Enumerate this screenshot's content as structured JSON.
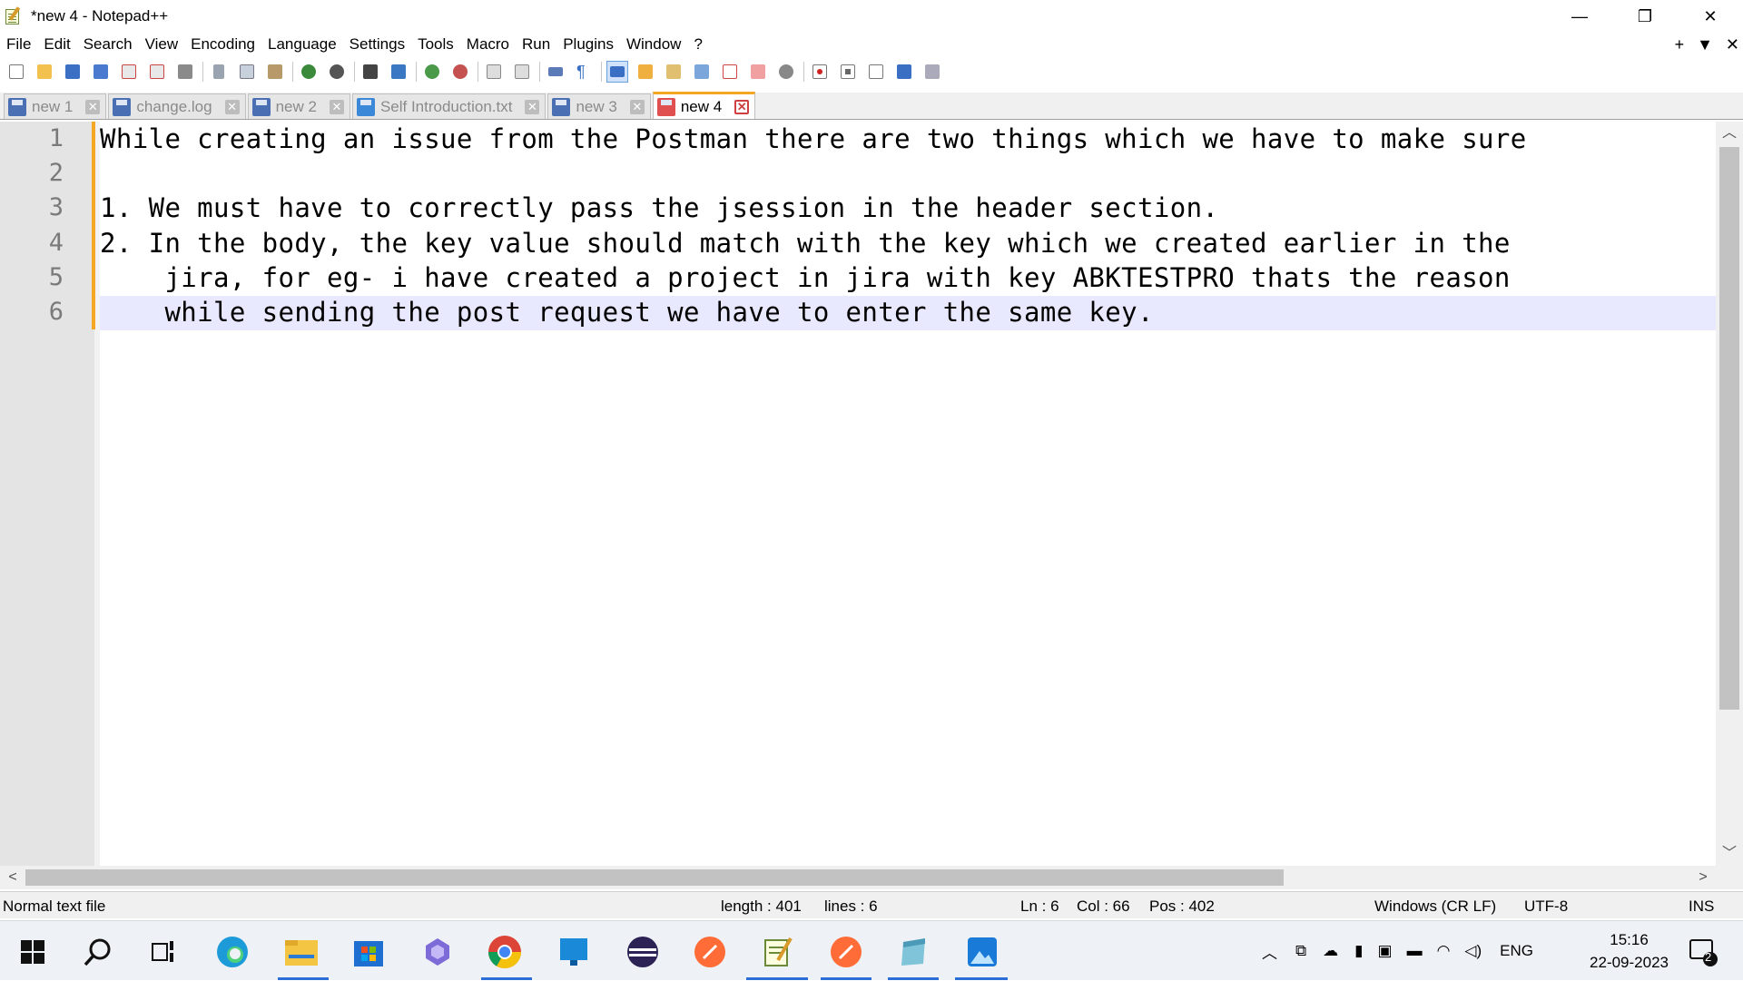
{
  "window": {
    "title": "*new 4 - Notepad++",
    "controls": {
      "minimize": "—",
      "restore": "❐",
      "close": "✕"
    }
  },
  "menu": {
    "items": [
      "File",
      "Edit",
      "Search",
      "View",
      "Encoding",
      "Language",
      "Settings",
      "Tools",
      "Macro",
      "Run",
      "Plugins",
      "Window",
      "?"
    ],
    "right": {
      "add": "+",
      "dropdown": "▼",
      "close": "✕"
    }
  },
  "tabs": [
    {
      "label": "new 1",
      "active": false,
      "icon": "saved-file-icon"
    },
    {
      "label": "change.log",
      "active": false,
      "icon": "saved-file-icon"
    },
    {
      "label": "new 2",
      "active": false,
      "icon": "saved-file-icon"
    },
    {
      "label": "Self Introduction.txt",
      "active": false,
      "icon": "saved-file-icon"
    },
    {
      "label": "new 3",
      "active": false,
      "icon": "saved-file-icon"
    },
    {
      "label": "new 4",
      "active": true,
      "icon": "unsaved-file-icon"
    }
  ],
  "editor": {
    "line_numbers": [
      "1",
      "2",
      "3",
      "4",
      "5",
      "6"
    ],
    "lines": [
      "While creating an issue from the Postman there are two things which we have to make sure",
      "",
      "1. We must have to correctly pass the jsession in the header section.",
      "2. In the body, the key value should match with the key which we created earlier in the",
      "    jira, for eg- i have created a project in jira with key ABKTESTPRO thats the reason",
      "    while sending the post request we have to enter the same key."
    ],
    "current_line": 6
  },
  "status": {
    "file_type": "Normal text file",
    "length": "length : 401",
    "lines": "lines : 6",
    "ln": "Ln : 6",
    "col": "Col : 66",
    "pos": "Pos : 402",
    "eol": "Windows (CR LF)",
    "encoding": "UTF-8",
    "mode": "INS"
  },
  "taskbar": {
    "tray": {
      "language": "ENG",
      "time": "15:16",
      "date": "22-09-2023",
      "notifications": "2"
    }
  },
  "colors": {
    "accent": "#f5a623",
    "current_line_bg": "#e8e8ff",
    "gutter_bg": "#e4e4e4",
    "taskbar_bg": "#eef1f6"
  }
}
